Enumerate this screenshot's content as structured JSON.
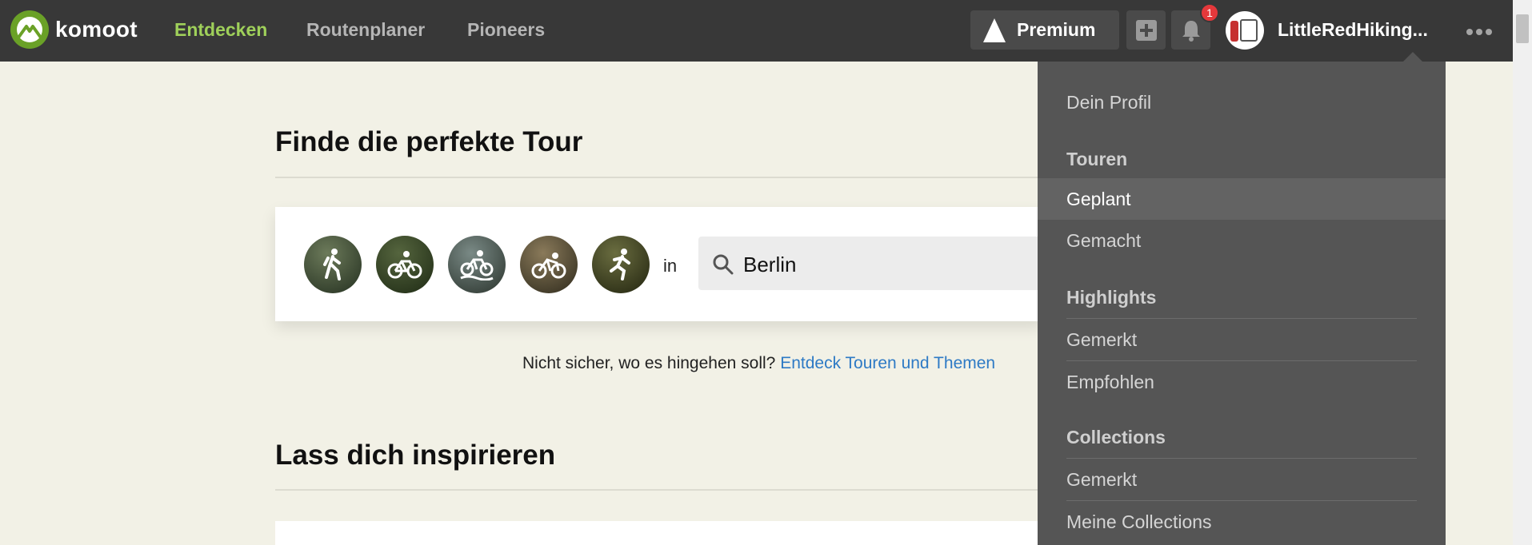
{
  "app": {
    "logo_text": "komoot",
    "brand_color": "#6aa127",
    "active_color": "#9fd05a"
  },
  "nav": {
    "items": [
      {
        "label": "Entdecken",
        "active": true
      },
      {
        "label": "Routenplaner",
        "active": false
      },
      {
        "label": "Pioneers",
        "active": false
      }
    ]
  },
  "header": {
    "premium_label": "Premium",
    "notification_count": "1",
    "username": "LittleRedHiking...",
    "icons": [
      "premium-tree-icon",
      "plus-icon",
      "bell-icon",
      "more-icon"
    ]
  },
  "main": {
    "find_title": "Finde die perfekte Tour",
    "sports": [
      {
        "name": "hiking",
        "icon": "hiker-icon"
      },
      {
        "name": "bike-touring",
        "icon": "bicycle-icon"
      },
      {
        "name": "mountain-biking",
        "icon": "mtb-icon"
      },
      {
        "name": "road-cycling",
        "icon": "roadbike-icon"
      },
      {
        "name": "running",
        "icon": "runner-icon"
      }
    ],
    "in_label": "in",
    "search_value": "Berlin",
    "hint_text": "Nicht sicher, wo es hingehen soll?",
    "hint_link": "Entdeck Touren und Themen",
    "inspire_title": "Lass dich inspirieren"
  },
  "dropdown": {
    "profile": "Dein Profil",
    "tours_header": "Touren",
    "tours_planned": "Geplant",
    "tours_done": "Gemacht",
    "highlights_header": "Highlights",
    "highlights_saved": "Gemerkt",
    "highlights_recommended": "Empfohlen",
    "collections_header": "Collections",
    "collections_saved": "Gemerkt",
    "collections_mine": "Meine Collections"
  }
}
